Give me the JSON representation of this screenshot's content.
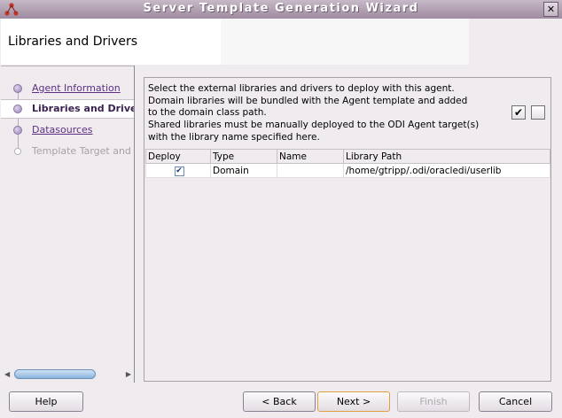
{
  "window": {
    "title": "Server Template Generation Wizard",
    "close_label": "✕"
  },
  "header": {
    "title": "Libraries and Drivers"
  },
  "nav": {
    "items": [
      {
        "label": "Agent Information",
        "state": "link"
      },
      {
        "label": "Libraries and Drivers",
        "state": "current"
      },
      {
        "label": "Datasources",
        "state": "link"
      },
      {
        "label": "Template Target and Summary",
        "state": "disabled"
      }
    ]
  },
  "content": {
    "description": [
      "Select the external libraries and drivers to deploy with this agent.",
      "Domain libraries will be bundled with the Agent template and added",
      "to the domain class path.",
      "Shared libraries must be manually deployed to the ODI Agent target(s)",
      "with the library name specified here."
    ],
    "select_all_glyph": "✔",
    "table": {
      "columns": [
        "Deploy",
        "Type",
        "Name",
        "Library Path"
      ],
      "rows": [
        {
          "deploy": "✔",
          "type": "Domain",
          "name": "",
          "path": "/home/gtripp/.odi/oracledi/userlib"
        }
      ]
    }
  },
  "buttons": {
    "help": "Help",
    "back": "< Back",
    "next": "Next >",
    "finish": "Finish",
    "cancel": "Cancel"
  },
  "colors": {
    "accent": "#5c2f82",
    "titlebar": "#9e8a9f",
    "focus": "#e0a040"
  }
}
